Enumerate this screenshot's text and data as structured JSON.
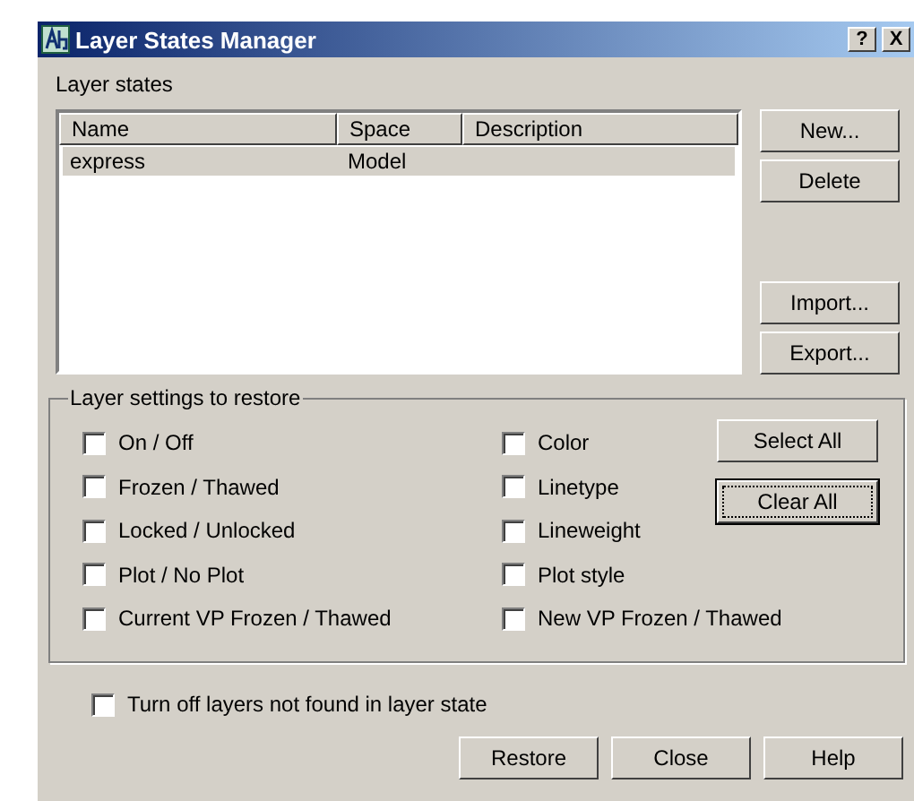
{
  "window": {
    "title": "Layer States Manager",
    "title_buttons": [
      "?",
      "X"
    ]
  },
  "layer_states": {
    "label": "Layer states",
    "columns": [
      "Name",
      "Space",
      "Description"
    ],
    "rows": [
      {
        "cells": [
          "express",
          "Model",
          ""
        ],
        "selected": true
      }
    ],
    "buttons": [
      "New...",
      "Delete",
      "Import...",
      "Export..."
    ]
  },
  "settings_group": {
    "title": "Layer settings to restore",
    "settings": [
      {
        "label": "On / Off",
        "checked": false
      },
      {
        "label": "Frozen / Thawed",
        "checked": false
      },
      {
        "label": "Locked / Unlocked",
        "checked": false
      },
      {
        "label": "Plot / No Plot",
        "checked": false
      },
      {
        "label": "Current VP Frozen / Thawed",
        "checked": false
      },
      {
        "label": "Color",
        "checked": false
      },
      {
        "label": "Linetype",
        "checked": false
      },
      {
        "label": "Lineweight",
        "checked": false
      },
      {
        "label": "Plot style",
        "checked": false
      },
      {
        "label": "New VP Frozen / Thawed",
        "checked": false
      }
    ],
    "buttons": [
      {
        "label": "Select All",
        "focused": false
      },
      {
        "label": "Clear All",
        "focused": true
      }
    ]
  },
  "turn_off_option": {
    "label": "Turn off layers not found in layer state",
    "checked": false
  },
  "footer_buttons": [
    "Restore",
    "Close",
    "Help"
  ]
}
